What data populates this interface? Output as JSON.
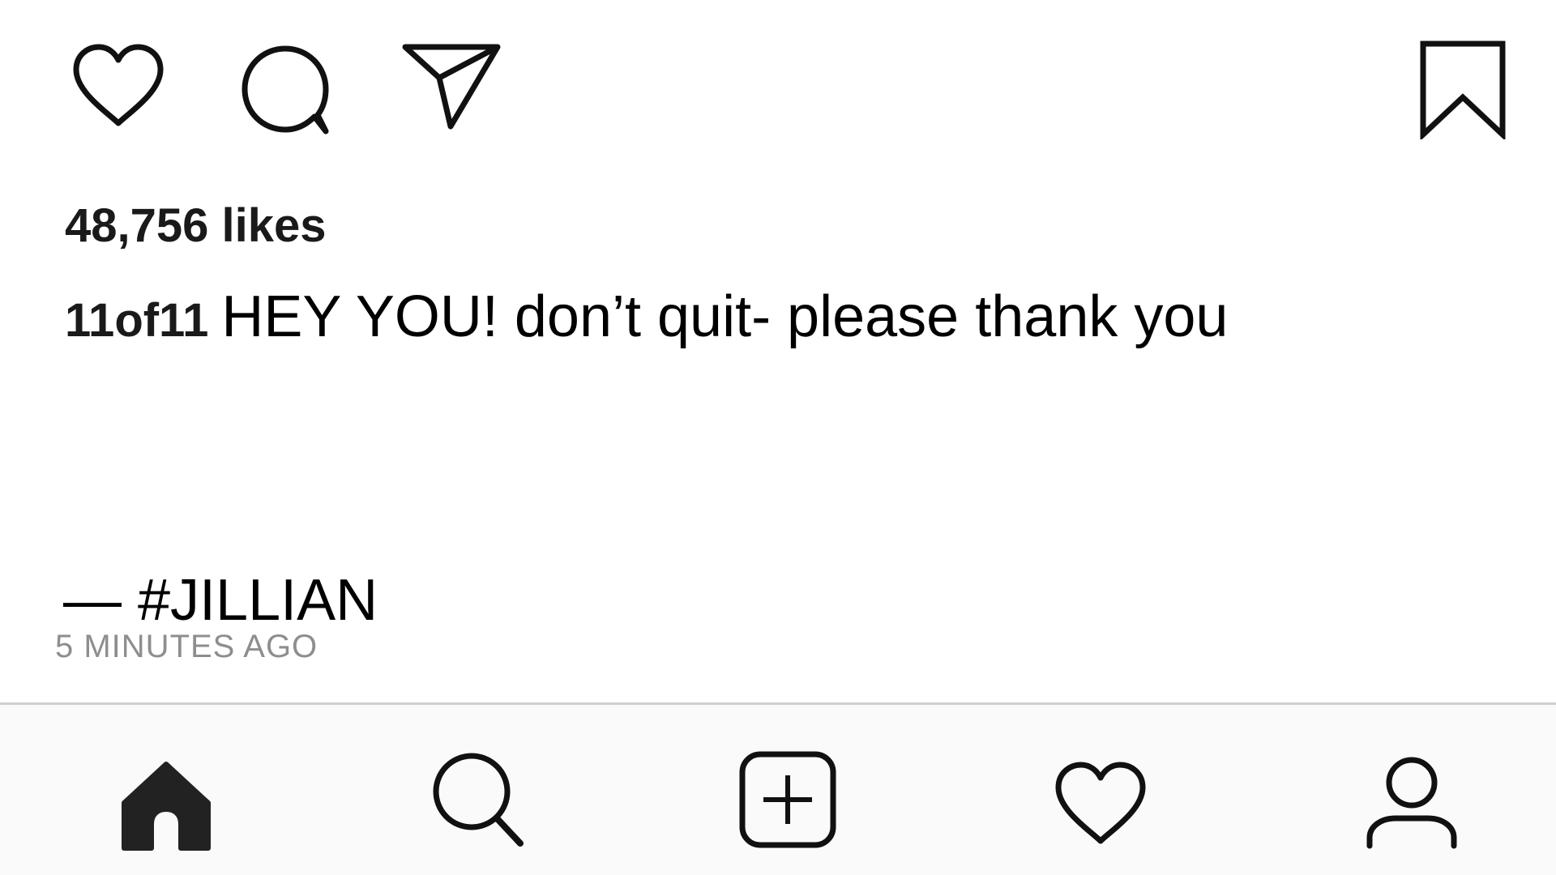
{
  "post": {
    "actions": {
      "like_icon": "heart-outline-icon",
      "comment_icon": "comment-bubble-icon",
      "share_icon": "paper-plane-icon",
      "save_icon": "bookmark-icon"
    },
    "likes_text": "48,756 likes",
    "caption": {
      "username": "11of11",
      "text": "HEY YOU! don’t quit- please thank you"
    },
    "signature": "— #JILLIAN",
    "timestamp": "5 MINUTES AGO"
  },
  "tab_bar": {
    "items": [
      {
        "icon": "home-icon",
        "active": true
      },
      {
        "icon": "search-icon",
        "active": false
      },
      {
        "icon": "add-post-icon",
        "active": false
      },
      {
        "icon": "activity-heart-icon",
        "active": false
      },
      {
        "icon": "profile-icon",
        "active": false
      }
    ]
  },
  "colors": {
    "text_primary": "#000000",
    "text_secondary": "#8e8e8e",
    "tab_bar_background": "#fafafa",
    "divider": "#cfcfcf"
  }
}
